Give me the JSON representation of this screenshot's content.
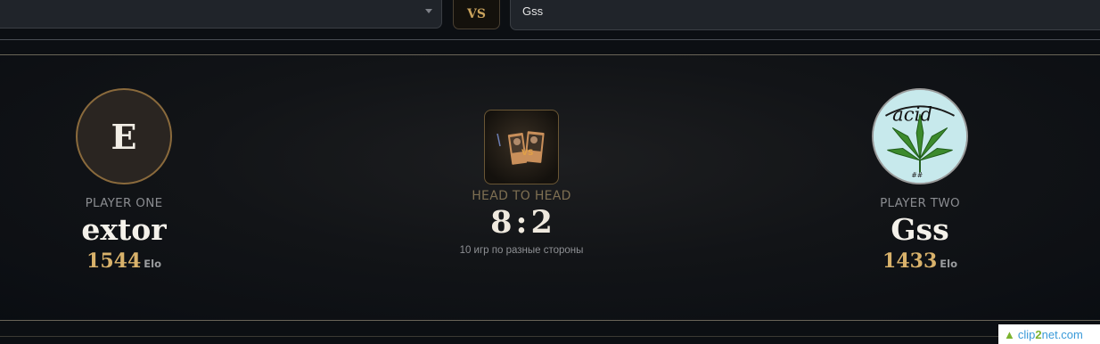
{
  "selector": {
    "left_value": "",
    "vs_label": "VS",
    "right_value": "Gss"
  },
  "player_one": {
    "role": "PLAYER ONE",
    "avatar_letter": "E",
    "name": "extor",
    "elo": "1544",
    "elo_unit": "Elo"
  },
  "player_two": {
    "role": "PLAYER TWO",
    "avatar_icon": "cannabis-leaf-avatar",
    "avatar_text": "acid",
    "name": "Gss",
    "elo": "1433",
    "elo_unit": "Elo"
  },
  "head_to_head": {
    "icon": "versus-portraits-icon",
    "label": "HEAD TO HEAD",
    "score_left": "8",
    "score_sep": ":",
    "score_right": "2",
    "note": "10 игр по разные стороны"
  },
  "watermark": {
    "part1": "clip",
    "part2": "2",
    "part3": "net.com"
  },
  "colors": {
    "accent_gold": "#d9b26b",
    "background": "#0c0f13"
  }
}
